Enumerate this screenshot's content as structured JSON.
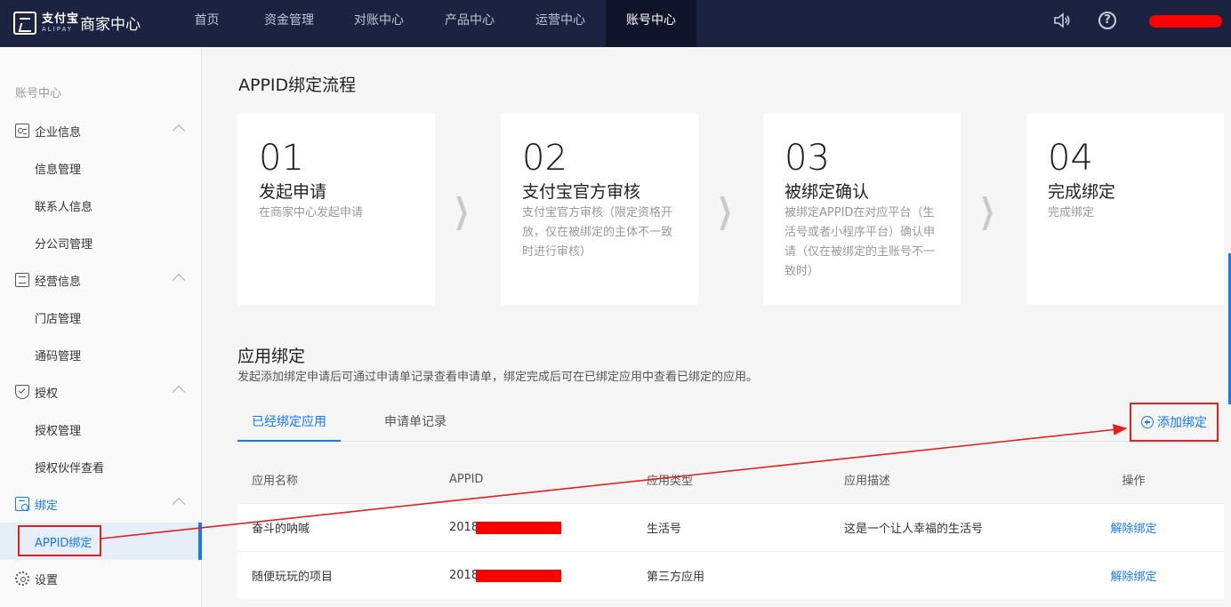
{
  "header": {
    "logo_cn": "支付宝",
    "logo_en": "ALIPAY",
    "title": "商家中心",
    "nav": [
      "首页",
      "资金管理",
      "对账中心",
      "产品中心",
      "运营中心",
      "账号中心"
    ],
    "active_nav": "账号中心",
    "help_symbol": "?"
  },
  "sidebar": {
    "header": "账号中心",
    "items": [
      {
        "label": "企业信息",
        "icon": "id-card-icon",
        "type": "section"
      },
      {
        "label": "信息管理",
        "type": "sub"
      },
      {
        "label": "联系人信息",
        "type": "sub"
      },
      {
        "label": "分公司管理",
        "type": "sub"
      },
      {
        "label": "经营信息",
        "icon": "document-list-icon",
        "type": "section"
      },
      {
        "label": "门店管理",
        "type": "sub"
      },
      {
        "label": "通码管理",
        "type": "sub"
      },
      {
        "label": "授权",
        "icon": "shield-check-icon",
        "type": "section"
      },
      {
        "label": "授权管理",
        "type": "sub"
      },
      {
        "label": "授权伙伴查看",
        "type": "sub"
      },
      {
        "label": "绑定",
        "icon": "bind-icon",
        "type": "section"
      },
      {
        "label": "APPID绑定",
        "type": "sub",
        "active": true
      },
      {
        "label": "设置",
        "icon": "gear-icon",
        "type": "section"
      }
    ]
  },
  "main": {
    "title": "APPID绑定流程",
    "steps": [
      {
        "num": "01",
        "title": "发起申请",
        "desc": "在商家中心发起申请"
      },
      {
        "num": "02",
        "title": "支付宝官方审核",
        "desc": "支付宝官方审核（限定资格开放，仅在被绑定的主体不一致时进行审核）"
      },
      {
        "num": "03",
        "title": "被绑定确认",
        "desc": "被绑定APPID在对应平台（生活号或者小程序平台）确认申请（仅在被绑定的主账号不一致时）"
      },
      {
        "num": "04",
        "title": "完成绑定",
        "desc": "完成绑定"
      }
    ],
    "step_arrow": "❯",
    "section_title": "应用绑定",
    "section_desc": "发起添加绑定申请后可通过申请单记录查看申请单，绑定完成后可在已绑定应用中查看已绑定的应用。",
    "tabs": [
      "已经绑定应用",
      "申请单记录"
    ],
    "add_button": "添加绑定",
    "table": {
      "headers": [
        "应用名称",
        "APPID",
        "应用类型",
        "应用描述",
        "操作"
      ],
      "rows": [
        {
          "name": "奋斗的呐喊",
          "appid_prefix": "2018",
          "type": "生活号",
          "desc": "这是一个让人幸福的生活号",
          "action": "解除绑定"
        },
        {
          "name": "随便玩玩的项目",
          "appid_prefix": "2018",
          "type": "第三方应用",
          "desc": "",
          "action": "解除绑定"
        }
      ]
    }
  },
  "colors": {
    "topbar": "#1c2340",
    "accent": "#1677ff",
    "annotation_red": "#e0211f"
  }
}
